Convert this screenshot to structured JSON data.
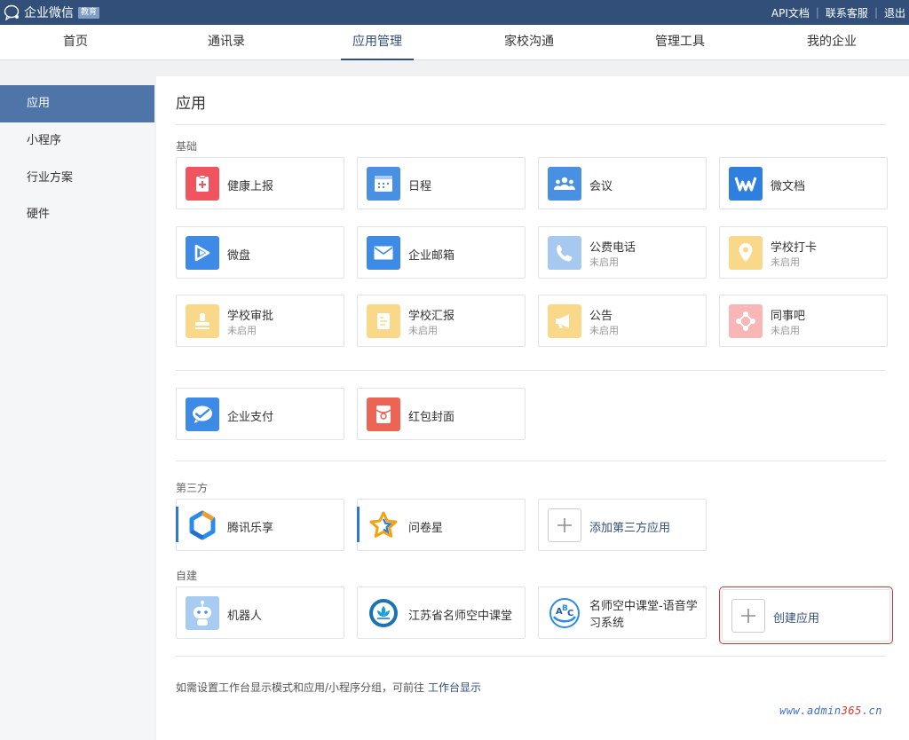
{
  "topbar": {
    "brand": "企业微信",
    "badge": "教育",
    "links": [
      "API文档",
      "联系客服",
      "退出"
    ]
  },
  "nav": {
    "items": [
      "首页",
      "通讯录",
      "应用管理",
      "家校沟通",
      "管理工具",
      "我的企业"
    ],
    "active": "应用管理"
  },
  "sidebar": {
    "items": [
      "应用",
      "小程序",
      "行业方案",
      "硬件"
    ],
    "active": "应用"
  },
  "main": {
    "title": "应用",
    "sections": {
      "basic": "基础",
      "third": "第三方",
      "custom": "自建"
    },
    "status_disabled": "未启用",
    "basic_apps": [
      {
        "name": "健康上报",
        "icon": "health-report-icon",
        "color": "#f0545e"
      },
      {
        "name": "日程",
        "icon": "calendar-icon",
        "color": "#4a90e2"
      },
      {
        "name": "会议",
        "icon": "meeting-icon",
        "color": "#4a90e2"
      },
      {
        "name": "微文档",
        "icon": "document-icon",
        "color": "#2f7fe0"
      },
      {
        "name": "微盘",
        "icon": "drive-icon",
        "color": "#3d8be6"
      },
      {
        "name": "企业邮箱",
        "icon": "mail-icon",
        "color": "#3d8be6"
      },
      {
        "name": "公费电话",
        "icon": "phone-icon",
        "color": "#a7c8ef",
        "status": "未启用"
      },
      {
        "name": "学校打卡",
        "icon": "checkin-icon",
        "color": "#fad889",
        "status": "未启用"
      },
      {
        "name": "学校审批",
        "icon": "approval-icon",
        "color": "#fad889",
        "status": "未启用"
      },
      {
        "name": "学校汇报",
        "icon": "report-icon",
        "color": "#fad889",
        "status": "未启用"
      },
      {
        "name": "公告",
        "icon": "announcement-icon",
        "color": "#fad889",
        "status": "未启用"
      },
      {
        "name": "同事吧",
        "icon": "colleague-icon",
        "color": "#f8b7b6",
        "status": "未启用"
      }
    ],
    "pay_apps": [
      {
        "name": "企业支付",
        "icon": "payment-icon",
        "color": "#3d8be6"
      },
      {
        "name": "红包封面",
        "icon": "red-packet-icon",
        "color": "#ec6454"
      }
    ],
    "third_apps": [
      {
        "name": "腾讯乐享",
        "icon": "tencent-lexiang-icon"
      },
      {
        "name": "问卷星",
        "icon": "star-icon"
      },
      {
        "name": "添加第三方应用",
        "icon": "plus-icon"
      }
    ],
    "custom_apps": [
      {
        "name": "机器人",
        "icon": "robot-icon"
      },
      {
        "name": "江苏省名师空中课堂",
        "icon": "school-logo-icon"
      },
      {
        "name": "名师空中课堂-语音学习系统",
        "icon": "abc-learning-icon"
      },
      {
        "name": "创建应用",
        "icon": "plus-icon"
      }
    ],
    "footnote": "如需设置工作台显示模式和应用/小程序分组，可前往",
    "footnote_link": "工作台显示"
  },
  "watermark": {
    "a": "www.admin",
    "b": "365",
    "c": ".cn"
  }
}
